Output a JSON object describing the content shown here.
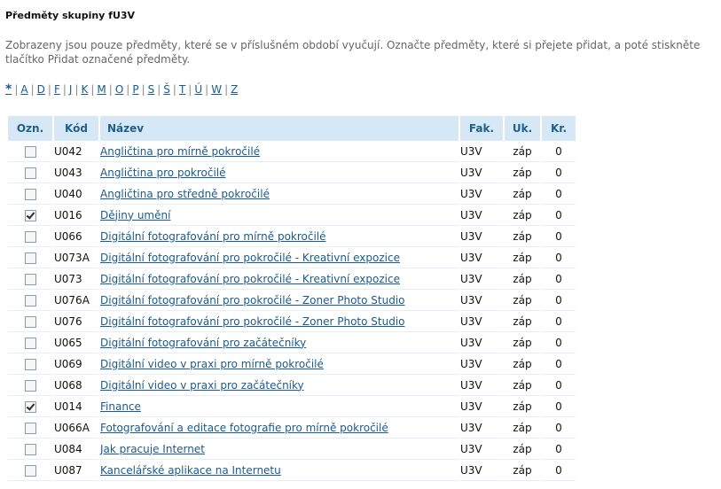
{
  "page_title": "Předměty skupiny fU3V",
  "description": "Zobrazeny jsou pouze předměty, které se v příslušném období vyučují. Označte předměty, které si přejete přidat, a poté stiskněte tlačítko Přidat označené předměty.",
  "alphabet": [
    "*",
    "A",
    "D",
    "F",
    "J",
    "K",
    "M",
    "O",
    "P",
    "S",
    "Š",
    "T",
    "Ú",
    "W",
    "Z"
  ],
  "table": {
    "headers": {
      "select": "Ozn.",
      "code": "Kód",
      "name": "Název",
      "faculty": "Fak.",
      "completion": "Uk.",
      "credits": "Kr."
    },
    "rows": [
      {
        "checked": false,
        "code": "U042",
        "name": "Angličtina pro mírně pokročilé",
        "faculty": "U3V",
        "completion": "záp",
        "credits": "0"
      },
      {
        "checked": false,
        "code": "U043",
        "name": "Angličtina pro pokročilé",
        "faculty": "U3V",
        "completion": "záp",
        "credits": "0"
      },
      {
        "checked": false,
        "code": "U040",
        "name": "Angličtina pro středně pokročilé",
        "faculty": "U3V",
        "completion": "záp",
        "credits": "0"
      },
      {
        "checked": true,
        "code": "U016",
        "name": "Dějiny umění",
        "faculty": "U3V",
        "completion": "záp",
        "credits": "0"
      },
      {
        "checked": false,
        "code": "U066",
        "name": "Digitální fotografování pro mírně pokročilé",
        "faculty": "U3V",
        "completion": "záp",
        "credits": "0"
      },
      {
        "checked": false,
        "code": "U073A",
        "name": "Digitální fotografování pro pokročilé - Kreativní expozice",
        "faculty": "U3V",
        "completion": "záp",
        "credits": "0"
      },
      {
        "checked": false,
        "code": "U073",
        "name": "Digitální fotografování pro pokročilé - Kreativní expozice",
        "faculty": "U3V",
        "completion": "záp",
        "credits": "0"
      },
      {
        "checked": false,
        "code": "U076A",
        "name": "Digitální fotografování pro pokročilé - Zoner Photo Studio",
        "faculty": "U3V",
        "completion": "záp",
        "credits": "0"
      },
      {
        "checked": false,
        "code": "U076",
        "name": "Digitální fotografování pro pokročilé - Zoner Photo Studio",
        "faculty": "U3V",
        "completion": "záp",
        "credits": "0"
      },
      {
        "checked": false,
        "code": "U065",
        "name": "Digitální fotografování pro začátečníky",
        "faculty": "U3V",
        "completion": "záp",
        "credits": "0"
      },
      {
        "checked": false,
        "code": "U069",
        "name": "Digitální video v praxi pro mírně pokročilé",
        "faculty": "U3V",
        "completion": "záp",
        "credits": "0"
      },
      {
        "checked": false,
        "code": "U068",
        "name": "Digitální video v praxi pro začátečníky",
        "faculty": "U3V",
        "completion": "záp",
        "credits": "0"
      },
      {
        "checked": true,
        "code": "U014",
        "name": "Finance",
        "faculty": "U3V",
        "completion": "záp",
        "credits": "0"
      },
      {
        "checked": false,
        "code": "U066A",
        "name": "Fotografování a editace fotografie pro mírně pokročilé",
        "faculty": "U3V",
        "completion": "záp",
        "credits": "0"
      },
      {
        "checked": false,
        "code": "U084",
        "name": "Jak pracuje Internet",
        "faculty": "U3V",
        "completion": "záp",
        "credits": "0"
      },
      {
        "checked": false,
        "code": "U087",
        "name": "Kancelářské aplikace na Internetu",
        "faculty": "U3V",
        "completion": "záp",
        "credits": "0"
      }
    ]
  },
  "colors": {
    "header_bg": "#d6e8f5",
    "header_text": "#1f5f8b",
    "link": "#1a5b8e"
  }
}
